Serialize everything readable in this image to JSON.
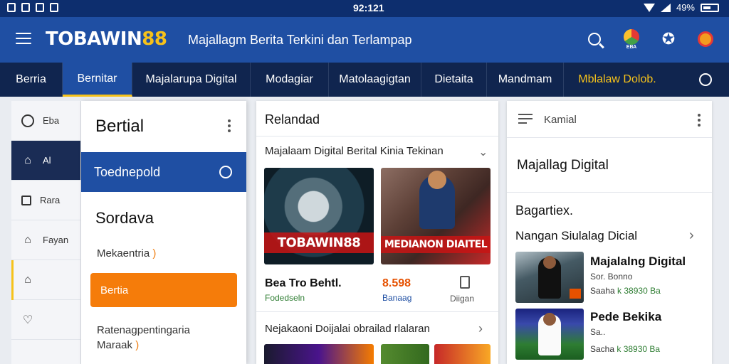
{
  "status_bar": {
    "time": "92:121",
    "battery": "49%"
  },
  "app_bar": {
    "logo_text": "TOBAWIN",
    "logo_num": "88",
    "tagline": "Majallagm Berita Terkini dan Terlampap",
    "badge_label": "ЕВА"
  },
  "tabs": [
    {
      "label": "Berria"
    },
    {
      "label": "Bernitar"
    },
    {
      "label": "Majalarupa Digital"
    },
    {
      "label": "Modagiar"
    },
    {
      "label": "Matolaagigtan"
    },
    {
      "label": "Dietaita"
    },
    {
      "label": "Mandmam"
    },
    {
      "label": "Mblalaw Dolob."
    }
  ],
  "rail": [
    {
      "label": "Eba"
    },
    {
      "label": "Al"
    },
    {
      "label": "Rara"
    },
    {
      "label": "Fayan"
    },
    {
      "label": ""
    },
    {
      "label": ""
    }
  ],
  "drawer": {
    "title": "Bertial",
    "active_item": "Toednepold",
    "subtitle": "Sordava",
    "link1": "Mekaentria",
    "link1_suffix": ")",
    "button": "Bertia",
    "link2_line1": "Ratenagpentingaria",
    "link2_line2": "Maraak",
    "link2_suffix": ")"
  },
  "center": {
    "header": "Relandad",
    "section1": "Majalaam Digital Berital Kinia Tekinan",
    "thumb1_caption": "TOBAWIN88",
    "thumb2_caption": "MEDIANON DIAITEL",
    "item_title": "Bea Tro Behtl.",
    "item_sub": "Fodedseln",
    "item_num": "8.598",
    "item_num_sub": "Banaag",
    "item_doc_label": "Diigan",
    "section2": "Nejakaoni Doijalai obrailad rlalaran"
  },
  "right": {
    "header": "Kamial",
    "title": "Majallag Digital",
    "section": "Bagartiex.",
    "section2": "Nangan Siulalag Dicial",
    "news": [
      {
        "title": "Majalalng Digital",
        "sub": "Sor. Bonno",
        "meta_label": "Saaha",
        "meta_value": "k 38930 Ba"
      },
      {
        "title": "Pede Bekika",
        "sub": "Sa..",
        "meta_label": "Sacha",
        "meta_value": "k 38930 Ba"
      }
    ]
  }
}
